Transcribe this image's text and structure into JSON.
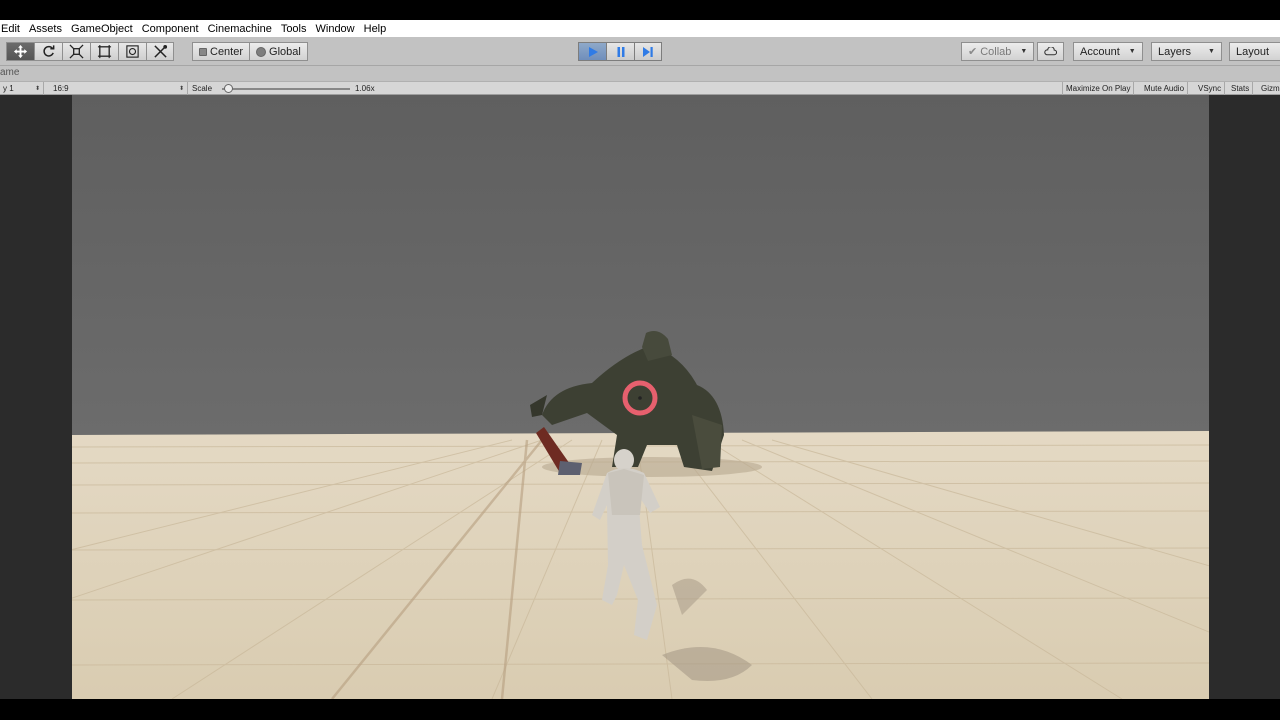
{
  "menu": [
    "Edit",
    "Assets",
    "GameObject",
    "Component",
    "Cinemachine",
    "Tools",
    "Window",
    "Help"
  ],
  "toolbar": {
    "transform_tools": [
      {
        "name": "move-tool",
        "icon": "move-icon",
        "active": true
      },
      {
        "name": "rotate-tool",
        "icon": "rotate-icon",
        "active": false
      },
      {
        "name": "scale-tool",
        "icon": "scale-icon",
        "active": false
      },
      {
        "name": "rect-tool",
        "icon": "rect-icon",
        "active": false
      },
      {
        "name": "transform-tool",
        "icon": "transform-icon",
        "active": false
      },
      {
        "name": "custom-tool",
        "icon": "custom-tool-icon",
        "active": false
      }
    ],
    "pivot_mode": "Center",
    "pivot_rotation": "Global",
    "collab": "Collab",
    "account": "Account",
    "layers": "Layers",
    "layout": "Layout",
    "play_state": "playing"
  },
  "game_view": {
    "tab": "ame",
    "display": "y 1",
    "aspect": "16:9",
    "scale_label": "Scale",
    "scale_value": "1.06x",
    "scale_slider": 0.05,
    "toggles": [
      "Maximize On Play",
      "Mute Audio",
      "VSync",
      "Stats",
      "Gizm"
    ]
  },
  "colors": {
    "sky": "#666666",
    "floor": "#dfd3bb",
    "crosshair": "#e85a6a",
    "play_accent": "#3b7fe0"
  }
}
